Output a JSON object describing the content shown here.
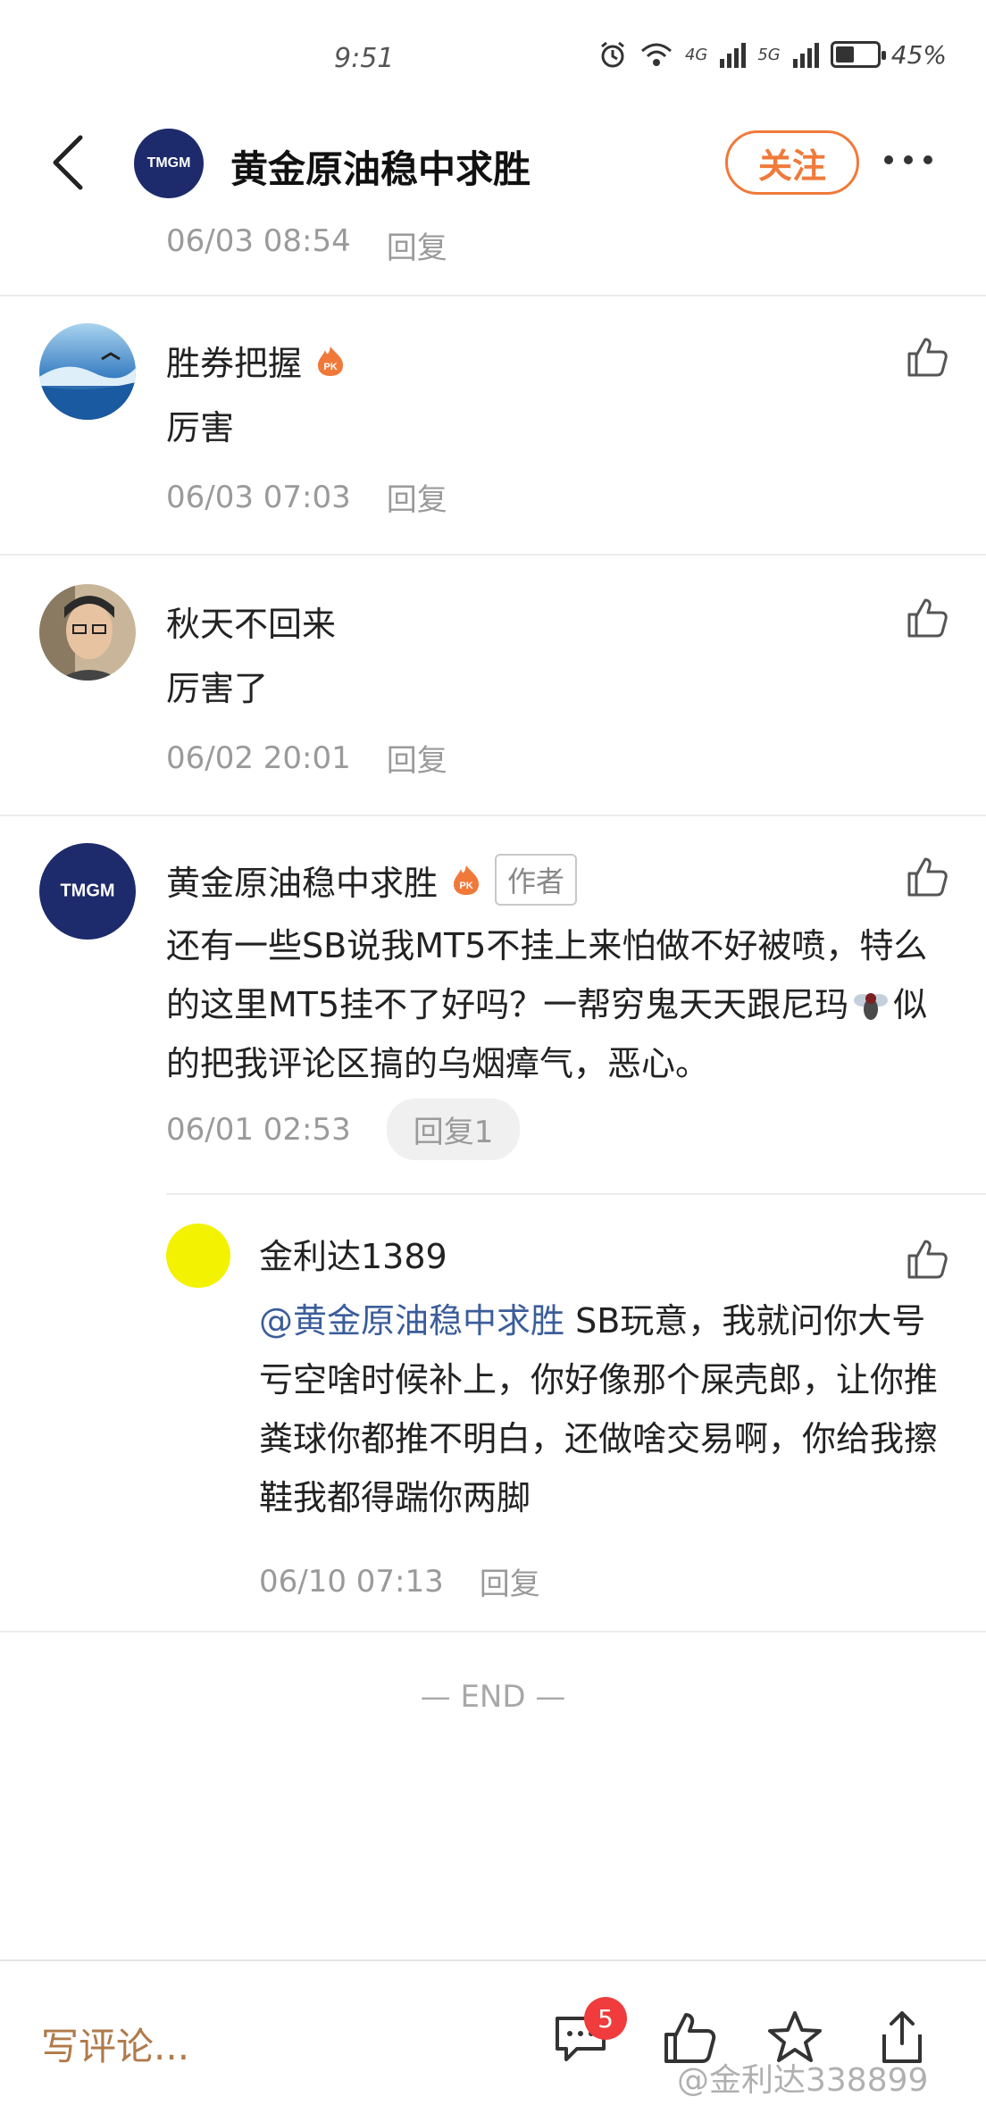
{
  "status": {
    "time": "9:51",
    "net1": "4G",
    "net2": "5G",
    "battery": "45%"
  },
  "header": {
    "title": "黄金原油稳中求胜",
    "follow_label": "关注",
    "avatar_logo": "TMGM"
  },
  "partial": {
    "time": "06/03 08:54",
    "reply": "回复"
  },
  "comments": [
    {
      "name": "胜券把握",
      "text": "厉害",
      "time": "06/03 07:03",
      "reply": "回复"
    },
    {
      "name": "秋天不回来",
      "text": "厉害了",
      "time": "06/02 20:01",
      "reply": "回复"
    },
    {
      "name": "黄金原油稳中求胜",
      "author_tag": "作者",
      "text_a": "还有一些SB说我MT5不挂上来怕做不好被喷，特么的这里MT5挂不了好吗？一帮穷鬼天天跟尼玛",
      "text_b": "似的把我评论区搞的乌烟瘴气，恶心。",
      "time": "06/01 02:53",
      "reply": "回复1"
    }
  ],
  "sub_reply": {
    "name": "金利达1389",
    "mention": "@黄金原油稳中求胜",
    "text": " SB玩意，我就问你大号亏空啥时候补上，你好像那个屎壳郎，让你推粪球你都推不明白，还做啥交易啊，你给我擦鞋我都得踹你两脚",
    "time": "06/10 07:13",
    "reply": "回复"
  },
  "end_mark": "— END —",
  "bottom": {
    "input_placeholder": "写评论...",
    "comment_count": "5",
    "watermark": "@金利达338899"
  },
  "colors": {
    "accent": "#f07a3a",
    "mention": "#3b5d9a",
    "badge": "#f03c3c"
  },
  "icons": {
    "fire_badge": "fire-pk-icon",
    "like": "thumbs-up-icon",
    "fly": "fly-emoji-icon"
  }
}
